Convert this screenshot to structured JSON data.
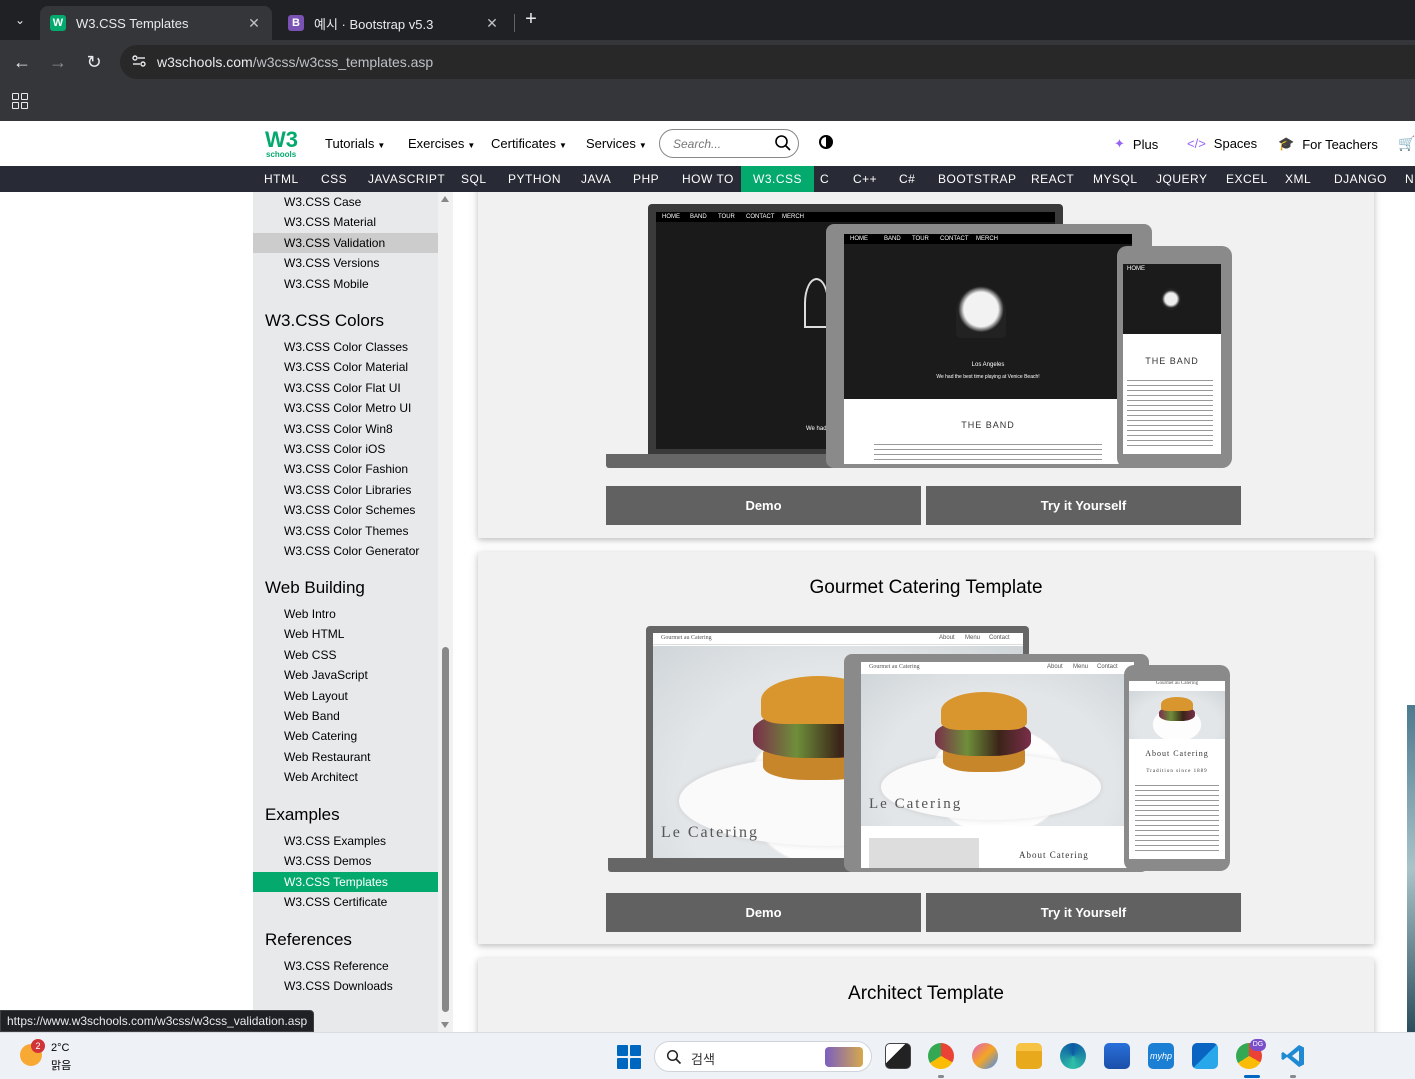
{
  "browser": {
    "tabs": [
      {
        "title": "W3.CSS Templates",
        "favicon": "W",
        "favicon_color": "#04aa6d"
      },
      {
        "title": "예시 · Bootstrap v5.3",
        "favicon": "B",
        "favicon_color": "#7952b3"
      }
    ],
    "url_host": "w3schools.com",
    "url_path": "/w3css/w3css_templates.asp"
  },
  "w3nav": {
    "logo_text": "W3",
    "logo_sub": "schools",
    "menus": [
      "Tutorials",
      "Exercises",
      "Certificates",
      "Services"
    ],
    "search_placeholder": "Search...",
    "right": [
      "Plus",
      "Spaces",
      "For Teachers"
    ]
  },
  "topics": [
    "HTML",
    "CSS",
    "JAVASCRIPT",
    "SQL",
    "PYTHON",
    "JAVA",
    "PHP",
    "HOW TO",
    "W3.CSS",
    "C",
    "C++",
    "C#",
    "BOOTSTRAP",
    "REACT",
    "MYSQL",
    "JQUERY",
    "EXCEL",
    "XML",
    "DJANGO",
    "N"
  ],
  "active_topic": "W3.CSS",
  "sidebar": {
    "group0": [
      "W3.CSS Case",
      "W3.CSS Material",
      "W3.CSS Validation",
      "W3.CSS Versions",
      "W3.CSS Mobile"
    ],
    "colors_head": "W3.CSS Colors",
    "colors": [
      "W3.CSS Color Classes",
      "W3.CSS Color Material",
      "W3.CSS Color Flat UI",
      "W3.CSS Color Metro UI",
      "W3.CSS Color Win8",
      "W3.CSS Color iOS",
      "W3.CSS Color Fashion",
      "W3.CSS Color Libraries",
      "W3.CSS Color Schemes",
      "W3.CSS Color Themes",
      "W3.CSS Color Generator"
    ],
    "web_head": "Web Building",
    "web": [
      "Web Intro",
      "Web HTML",
      "Web CSS",
      "Web JavaScript",
      "Web Layout",
      "Web Band",
      "Web Catering",
      "Web Restaurant",
      "Web Architect"
    ],
    "examples_head": "Examples",
    "examples": [
      "W3.CSS Examples",
      "W3.CSS Demos",
      "W3.CSS Templates",
      "W3.CSS Certificate"
    ],
    "refs_head": "References",
    "refs": [
      "W3.CSS Reference",
      "W3.CSS Downloads"
    ]
  },
  "cards": {
    "band": {
      "demo": "Demo",
      "try": "Try it Yourself",
      "nav": [
        "HOME",
        "BAND",
        "TOUR",
        "CONTACT",
        "MERCH"
      ],
      "city": "Los Angeles",
      "tagline": "We had the best time playing at Venice Beach!",
      "band_title": "THE BAND",
      "fan_caption": "We had th"
    },
    "catering": {
      "title": "Gourmet Catering Template",
      "demo": "Demo",
      "try": "Try it Yourself",
      "site_name": "Gourmet au Catering",
      "nav": [
        "About",
        "Menu",
        "Contact"
      ],
      "hero": "Le Catering",
      "about": "About Catering",
      "tradition": "Tradition since 1889"
    },
    "architect": {
      "title": "Architect Template"
    }
  },
  "status_url": "https://www.w3schools.com/w3css/w3css_validation.asp",
  "taskbar": {
    "weather_badge": "2",
    "temp": "2°C",
    "weather": "맑음",
    "search_placeholder": "검색",
    "profile_badge": "DG"
  },
  "colors": {
    "w3_green": "#04aa6d",
    "topic_bar": "#282a35",
    "button_gray": "#616161",
    "sidebar_bg": "#e7e9eb",
    "accent_purple": "#9763f6"
  }
}
